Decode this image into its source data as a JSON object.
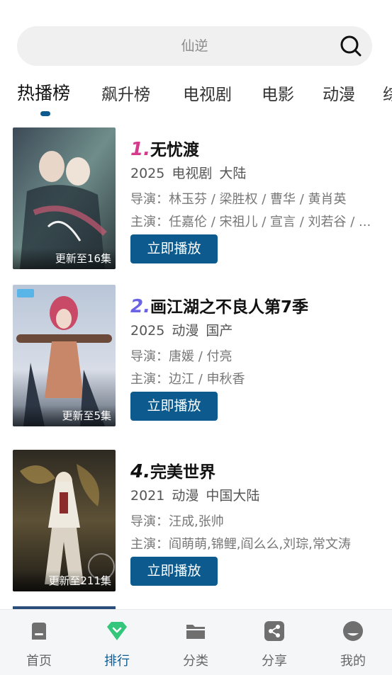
{
  "search": {
    "placeholder": "仙逆"
  },
  "tabs": [
    {
      "label": "热播榜",
      "active": true
    },
    {
      "label": "飙升榜",
      "active": false
    },
    {
      "label": "电视剧",
      "active": false
    },
    {
      "label": "电影",
      "active": false
    },
    {
      "label": "动漫",
      "active": false
    },
    {
      "label": "综",
      "active": false
    }
  ],
  "list": [
    {
      "rank": "1.",
      "rank_color": "#d63a8c",
      "title": "无忧渡",
      "year": "2025",
      "type": "电视剧",
      "region": "大陆",
      "director": "导演：林玉芬 / 梁胜权 / 曹华 / 黄肖英",
      "actors": "主演：任嘉伦 / 宋祖儿 / 宣言 / 刘若谷 / ...",
      "badge": "更新至16集",
      "play_label": "立即播放"
    },
    {
      "rank": "2.",
      "rank_color": "#6b63e6",
      "title": "画江湖之不良人第7季",
      "year": "2025",
      "type": "动漫",
      "region": "国产",
      "director": "导演：唐媛 / 付亮",
      "actors": "主演：边江 / 申秋香",
      "badge": "更新至5集",
      "play_label": "立即播放"
    },
    {
      "rank": "4.",
      "rank_color": "#111111",
      "title": "完美世界",
      "year": "2021",
      "type": "动漫",
      "region": "中国大陆",
      "director": "导演：汪成,张帅",
      "actors": "主演：阎萌萌,锦鲤,阎么么,刘琮,常文涛",
      "badge": "更新至211集",
      "play_label": "立即播放"
    }
  ],
  "nav": [
    {
      "label": "首页",
      "icon": "home-icon"
    },
    {
      "label": "排行",
      "icon": "rank-icon",
      "active": true
    },
    {
      "label": "分类",
      "icon": "folder-icon"
    },
    {
      "label": "分享",
      "icon": "share-icon"
    },
    {
      "label": "我的",
      "icon": "profile-icon"
    }
  ],
  "colors": {
    "accent": "#0d5b8e",
    "active_nav_icon": "#34c77b"
  }
}
